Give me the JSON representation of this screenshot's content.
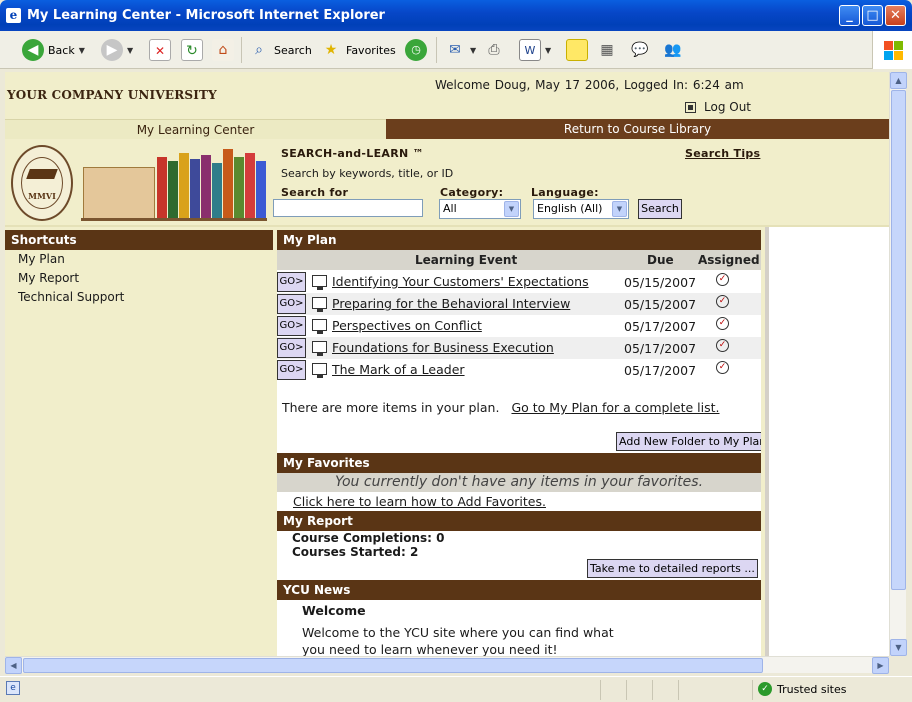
{
  "window": {
    "title": "My Learning Center - Microsoft Internet Explorer",
    "buttons": {
      "minimize": "_",
      "maximize": "□",
      "close": "✕"
    }
  },
  "toolbar": {
    "back_label": "Back",
    "search_label": "Search",
    "favorites_label": "Favorites"
  },
  "header": {
    "university_name": "YOUR COMPANY UNIVERSITY",
    "welcome_text": "Welcome  Doug,  May 17 2006,  Logged In:  6:24 am",
    "logout_label": "Log Out"
  },
  "tabs": {
    "active": "My Learning Center",
    "other": "Return to Course Library"
  },
  "search": {
    "title": "SEARCH-and-LEARN ™",
    "tips_label": "Search Tips",
    "hint": "Search by keywords, title, or ID",
    "search_for_label": "Search for",
    "search_value": "",
    "category_label": "Category:",
    "category_value": "All",
    "language_label": "Language:",
    "language_value": "English (All)",
    "button_label": "Search"
  },
  "logo": {
    "seal_text": "MMVI"
  },
  "shortcuts": {
    "title": "Shortcuts",
    "items": [
      "My Plan",
      "My Report",
      "Technical Support"
    ]
  },
  "my_plan": {
    "title": "My Plan",
    "columns": {
      "event": "Learning Event",
      "due": "Due",
      "assigned": "Assigned"
    },
    "go_label": "GO>",
    "rows": [
      {
        "event": "Identifying Your Customers' Expectations",
        "due": "05/15/2007"
      },
      {
        "event": "Preparing for the Behavioral Interview",
        "due": "05/15/2007"
      },
      {
        "event": "Perspectives on Conflict",
        "due": "05/17/2007"
      },
      {
        "event": "Foundations for Business Execution",
        "due": "05/17/2007"
      },
      {
        "event": "The Mark of a Leader",
        "due": "05/17/2007"
      }
    ],
    "more_text": "There are more items in your plan.",
    "more_link": "Go to My Plan for a complete list.",
    "add_folder_label": "Add New Folder to My Plan"
  },
  "my_favorites": {
    "title": "My Favorites",
    "empty_text": "You currently don't have any items in your favorites.",
    "help_link": "Click here to learn how to Add Favorites."
  },
  "my_report": {
    "title": "My Report",
    "completions": "Course Completions: 0",
    "started": "Courses Started: 2",
    "details_label": "Take me to detailed reports ..."
  },
  "news": {
    "title": "YCU News",
    "heading": "Welcome",
    "body": "Welcome to the YCU site where you can find what you need to learn whenever you need it!"
  },
  "statusbar": {
    "zone": "Trusted sites"
  }
}
